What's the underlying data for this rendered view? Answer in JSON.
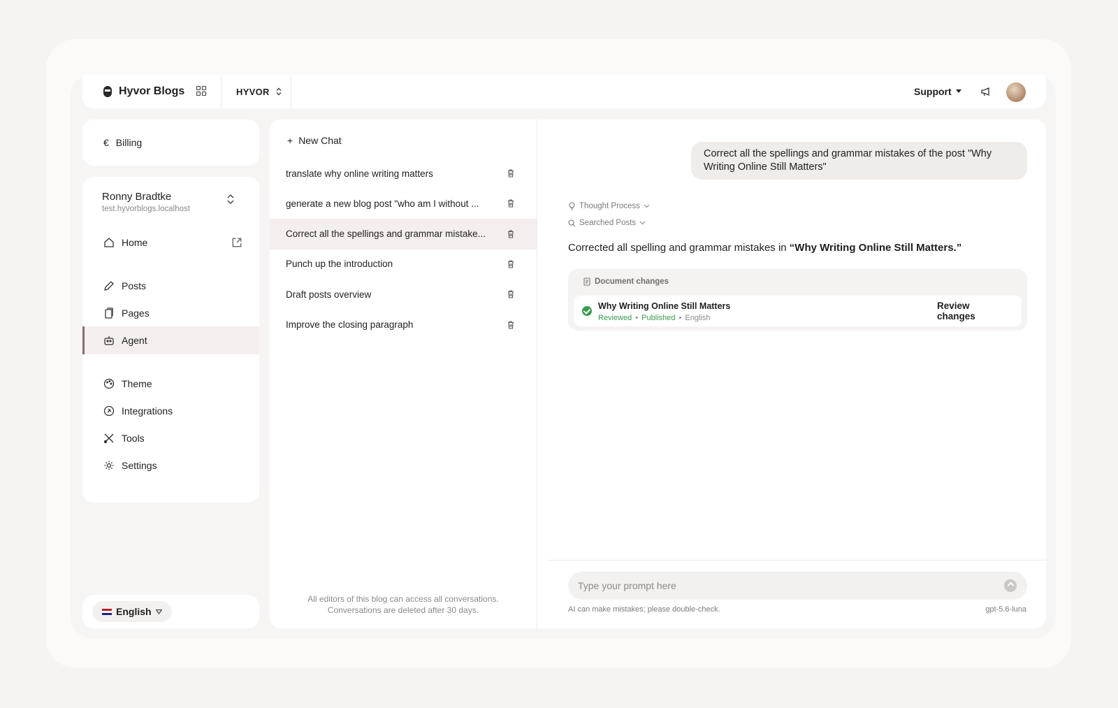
{
  "app": {
    "name": "Hyvor Blogs",
    "org": "HYVOR"
  },
  "header": {
    "support_label": "Support"
  },
  "billing": {
    "label": "Billing",
    "icon": "euro-icon"
  },
  "user": {
    "name": "Ronny Bradtke",
    "subdomain": "test.hyvorblogs.localhost"
  },
  "nav": {
    "home": "Home",
    "posts": "Posts",
    "pages": "Pages",
    "agent": "Agent",
    "theme": "Theme",
    "integrations": "Integrations",
    "tools": "Tools",
    "settings": "Settings"
  },
  "language": {
    "selected": "English"
  },
  "chats": {
    "new_chat": "New Chat",
    "items": [
      "translate why online writing matters",
      "generate a new blog post \"who am I without ...",
      "Correct all the spellings and grammar mistake...",
      "Punch up the introduction",
      "Draft posts overview",
      "Improve the closing paragraph"
    ],
    "active_index": 2,
    "note_line1": "All editors of this blog can access all conversations.",
    "note_line2": "Conversations are deleted after 30 days."
  },
  "conversation": {
    "user_message": "Correct all the spellings and grammar mistakes of the post \"Why Writing Online Still Matters\"",
    "thought_label": "Thought Process",
    "searched_label": "Searched Posts",
    "answer_prefix": "Corrected all spelling and grammar mistakes in ",
    "answer_bold": "“Why Writing Online Still Matters.”",
    "doc_changes_label": "Document changes",
    "doc_title": "Why Writing Online Still Matters",
    "doc_status_reviewed": "Reviewed",
    "doc_status_published": "Published",
    "doc_language": "English",
    "review_label": "Review changes"
  },
  "composer": {
    "placeholder": "Type your prompt here",
    "disclaimer": "AI can make mistakes; please double-check.",
    "model": "gpt-5.6-luna"
  },
  "colors": {
    "accent": "#8c6d6a",
    "success": "#3a9a4f",
    "background": "#f6f3f1"
  }
}
